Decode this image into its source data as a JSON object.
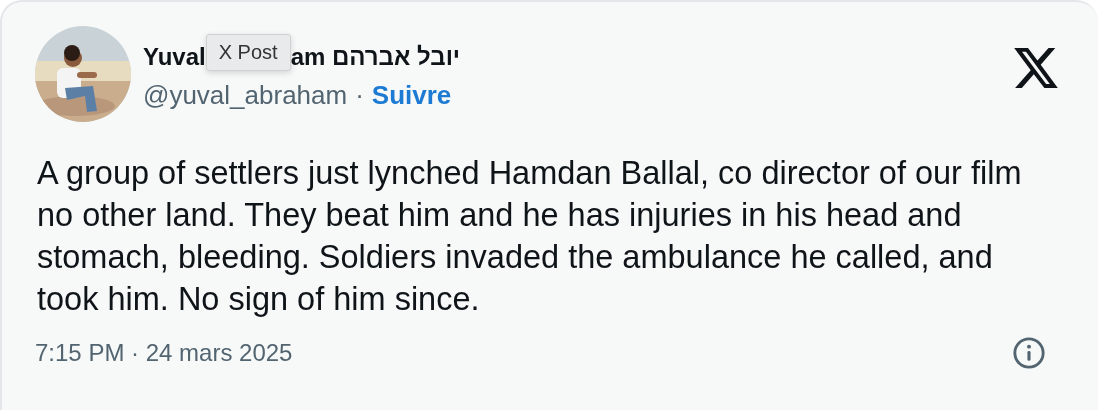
{
  "post": {
    "author_name_parts": [
      "Yuval",
      "am יובל אברהם"
    ],
    "handle": "@yuval_abraham",
    "separator": "·",
    "follow_link": "Suivre",
    "tooltip": "X Post",
    "text": "A group of settlers just lynched Hamdan Ballal, co director of our film no other land. They beat him and he has injuries in his head and stomach, bleeding. Soldiers invaded the ambulance he called, and took him. No sign of him since.",
    "timestamp": "7:15 PM · 24 mars 2025"
  }
}
